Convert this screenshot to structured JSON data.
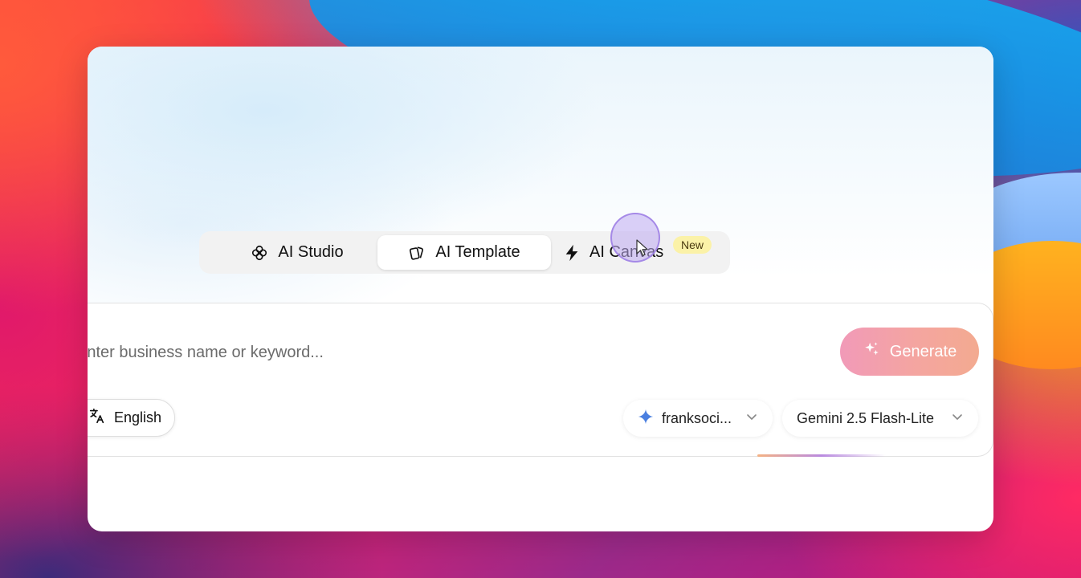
{
  "tabs": {
    "studio_label": "AI Studio",
    "template_label": "AI Template",
    "canvas_label": "AI Canvas",
    "new_badge": "New"
  },
  "prompt": {
    "placeholder": "Enter business name or keyword..."
  },
  "generate": {
    "label": "Generate"
  },
  "language": {
    "label": "English"
  },
  "account": {
    "label": "franksoci..."
  },
  "model": {
    "label": "Gemini 2.5 Flash-Lite"
  },
  "icons": {
    "studio": "flower-icon",
    "template": "cards-icon",
    "canvas": "lightning-icon",
    "generate": "sparkle-icon",
    "language": "translate-icon",
    "account": "gemini-star-icon",
    "dropdown": "chevron-down-icon",
    "cursor": "pointer-cursor-icon"
  },
  "colors": {
    "active_tab_bg": "#ffffff",
    "tabs_bg": "#f2f2f2",
    "badge_bg": "#fbf2a8",
    "generate_gradient_start": "#f19ab8",
    "generate_gradient_end": "#f3aa90",
    "gemini_blue": "#4a7fe0"
  }
}
